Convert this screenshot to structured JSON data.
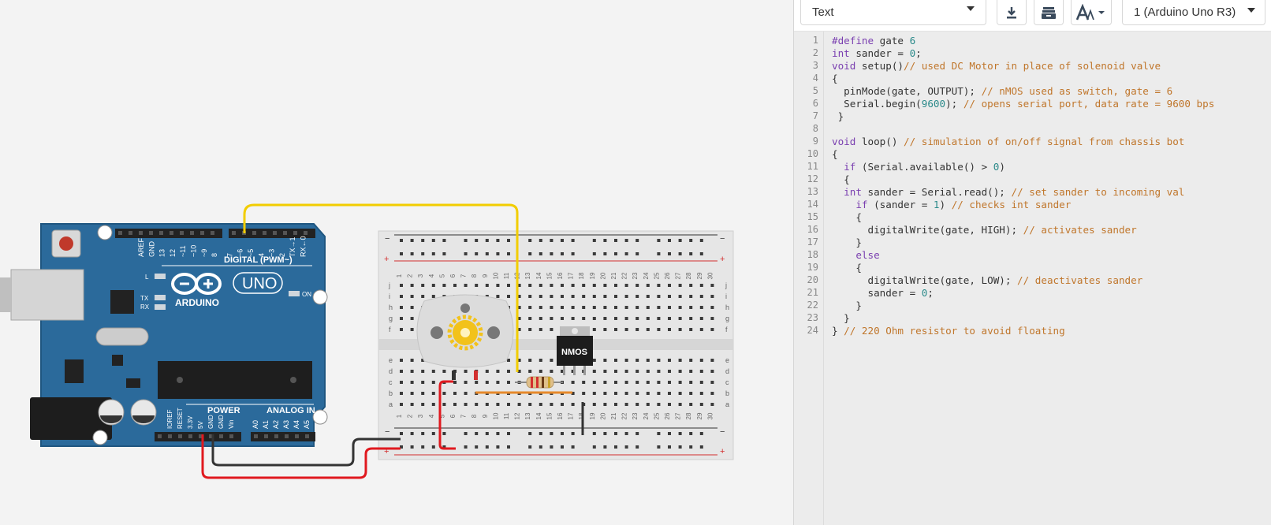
{
  "toolbar": {
    "mode_label": "Text",
    "board_label": "1 (Arduino Uno R3)",
    "icons": [
      "download-icon",
      "library-icon",
      "font-size-icon"
    ]
  },
  "circuit": {
    "arduino": {
      "brand": "ARDUINO",
      "model": "UNO",
      "digital_label": "DIGITAL (PWM~)",
      "power_label": "POWER",
      "analog_label": "ANALOG IN",
      "on_label": "ON",
      "led_labels": [
        "L",
        "TX",
        "RX"
      ],
      "top_pins": [
        "AREF",
        "GND",
        "13",
        "12",
        "~11",
        "~10",
        "~9",
        "8",
        "7",
        "~6",
        "~5",
        "4",
        "~3",
        "2",
        "TX→1",
        "RX←0"
      ],
      "power_pins": [
        "IOREF",
        "RESET",
        "3.3V",
        "5V",
        "GND",
        "GND",
        "Vin"
      ],
      "analog_pins": [
        "A0",
        "A1",
        "A2",
        "A3",
        "A4",
        "A5"
      ]
    },
    "breadboard": {
      "row_letters_top": [
        "j",
        "i",
        "h",
        "g",
        "f"
      ],
      "row_letters_bottom": [
        "e",
        "d",
        "c",
        "b",
        "a"
      ],
      "columns": 30,
      "rail_minus": "−",
      "rail_plus": "+"
    },
    "mosfet_label": "NMOS",
    "colors": {
      "board": "#2b6a9b",
      "wire_signal": "#f2cd00",
      "wire_gnd": "#333333",
      "wire_5v": "#e0191f",
      "motor_gear": "#f2c21b"
    }
  },
  "code_lines": [
    "#define gate 6",
    "int sander = 0;",
    "void setup()// used DC Motor in place of solenoid valve",
    "{",
    "  pinMode(gate, OUTPUT); // nMOS used as switch, gate = 6",
    "  Serial.begin(9600); // opens serial port, data rate = 9600 bps",
    " }",
    "",
    "void loop() // simulation of on/off signal from chassis bot",
    "{",
    "  if (Serial.available() > 0)",
    "  {",
    "  int sander = Serial.read(); // set sander to incoming val",
    "    if (sander = 1) // checks int sander",
    "    {",
    "      digitalWrite(gate, HIGH); // activates sander",
    "    }",
    "    else",
    "    {",
    "      digitalWrite(gate, LOW); // deactivates sander",
    "      sander = 0;",
    "    }",
    "  }",
    "} // 220 Ohm resistor to avoid floating"
  ]
}
